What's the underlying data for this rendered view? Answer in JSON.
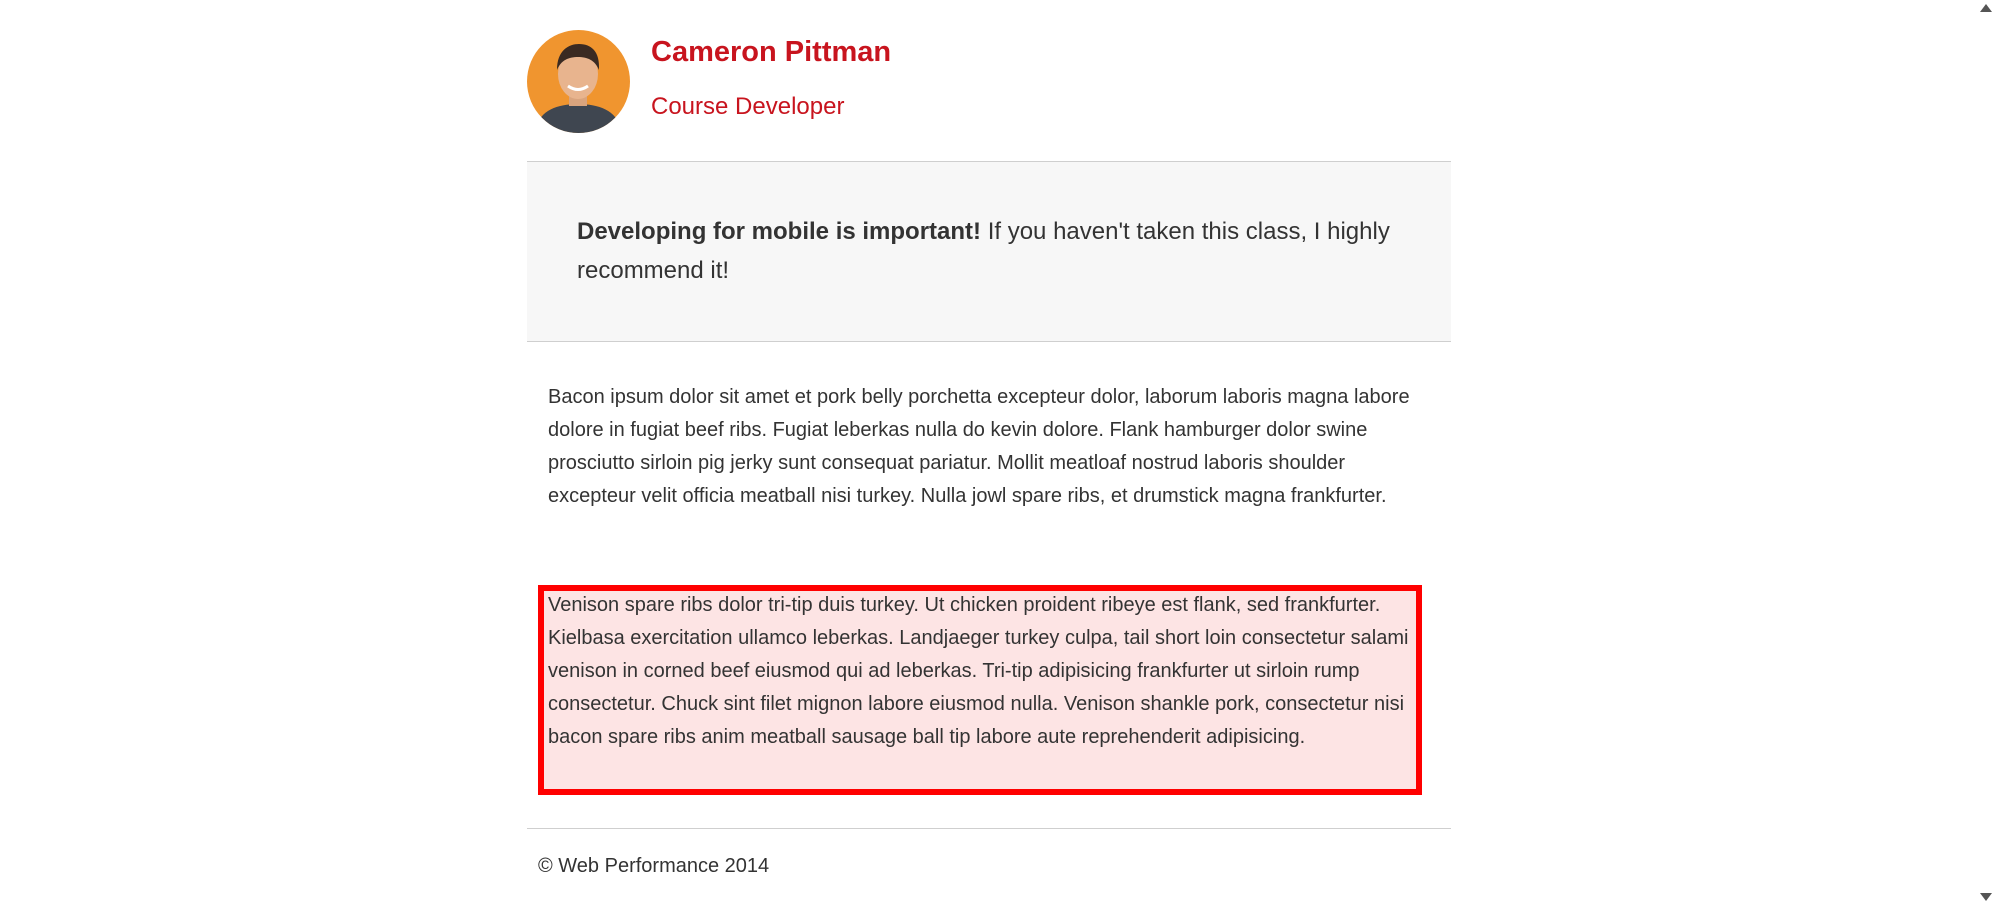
{
  "profile": {
    "name": "Cameron Pittman",
    "role": "Course Developer",
    "avatar_colors": {
      "background": "#f0952f",
      "skin": "#e8b48e",
      "hair": "#3a2a22",
      "shirt": "#3f4650"
    }
  },
  "callout": {
    "bold": "Developing for mobile is important!",
    "rest": " If you haven't taken this class, I highly recommend it!"
  },
  "content": {
    "paragraph1": "Bacon ipsum dolor sit amet et pork belly porchetta excepteur dolor, laborum laboris magna labore dolore in fugiat beef ribs. Fugiat leberkas nulla do kevin dolore. Flank hamburger dolor swine prosciutto sirloin pig jerky sunt consequat pariatur. Mollit meatloaf nostrud laboris shoulder excepteur velit officia meatball nisi turkey. Nulla jowl spare ribs, et drumstick magna frankfurter.",
    "paragraph2": "Venison spare ribs dolor tri-tip duis turkey. Ut chicken proident ribeye est flank, sed frankfurter. Kielbasa exercitation ullamco leberkas. Landjaeger turkey culpa, tail short loin consectetur salami venison in corned beef eiusmod qui ad leberkas. Tri-tip adipisicing frankfurter ut sirloin rump consectetur. Chuck sint filet mignon labore eiusmod nulla. Venison shankle pork, consectetur nisi bacon spare ribs anim meatball sausage ball tip labore aute reprehenderit adipisicing."
  },
  "footer": {
    "copyright": "© Web Performance 2014"
  },
  "highlight": {
    "border_color": "#ff0000",
    "fill_color": "#fde4e4"
  },
  "accent_color": "#c8141e"
}
